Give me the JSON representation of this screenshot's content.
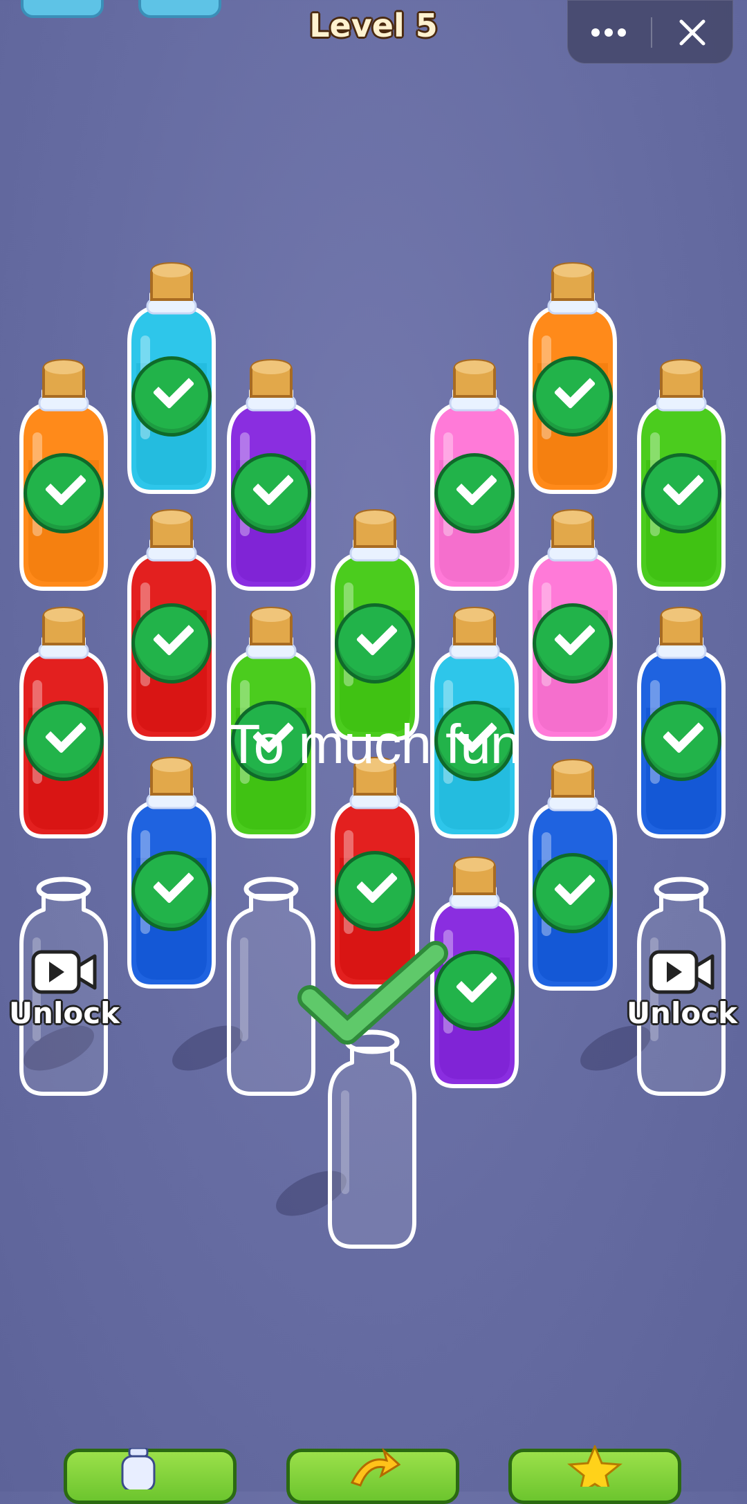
{
  "header": {
    "level_title": "Level 5",
    "more_icon": "more-dots-icon",
    "close_icon": "close-icon"
  },
  "caption": "To much fun",
  "unlock_label": "Unlock",
  "colors": {
    "orange": "#ff8a1a",
    "cyan": "#2ec6ea",
    "purple": "#8a2ee0",
    "pink": "#ff7ad8",
    "green": "#4bcc1e",
    "red": "#e3201f",
    "blue": "#1f63e0"
  },
  "bottles": [
    {
      "id": "r1c2",
      "color": "cyan",
      "state": "complete"
    },
    {
      "id": "r1c6",
      "color": "orange",
      "state": "complete"
    },
    {
      "id": "r2c1",
      "color": "orange",
      "state": "complete"
    },
    {
      "id": "r2c3",
      "color": "purple",
      "state": "complete"
    },
    {
      "id": "r2c5",
      "color": "pink",
      "state": "complete"
    },
    {
      "id": "r2c7",
      "color": "green",
      "state": "complete"
    },
    {
      "id": "r3c2",
      "color": "red",
      "state": "complete"
    },
    {
      "id": "r3c4",
      "color": "green",
      "state": "complete"
    },
    {
      "id": "r3c6",
      "color": "pink",
      "state": "complete"
    },
    {
      "id": "r4c1",
      "color": "red",
      "state": "complete"
    },
    {
      "id": "r4c3",
      "color": "green",
      "state": "complete"
    },
    {
      "id": "r4c5",
      "color": "cyan",
      "state": "complete"
    },
    {
      "id": "r4c7",
      "color": "blue",
      "state": "complete"
    },
    {
      "id": "r5c2",
      "color": "blue",
      "state": "complete"
    },
    {
      "id": "r5c4",
      "color": "red",
      "state": "complete"
    },
    {
      "id": "r5c6",
      "color": "blue",
      "state": "complete"
    },
    {
      "id": "r6c5",
      "color": "purple",
      "state": "complete"
    },
    {
      "id": "r6c1",
      "color": "empty",
      "state": "locked"
    },
    {
      "id": "r6c3",
      "color": "empty",
      "state": "empty"
    },
    {
      "id": "r6c7",
      "color": "empty",
      "state": "locked"
    },
    {
      "id": "r7c4",
      "color": "empty",
      "state": "empty"
    }
  ],
  "bottom_bar": [
    {
      "icon": "add-bottle-icon"
    },
    {
      "icon": "undo-arrow-icon"
    },
    {
      "icon": "star-icon"
    }
  ]
}
